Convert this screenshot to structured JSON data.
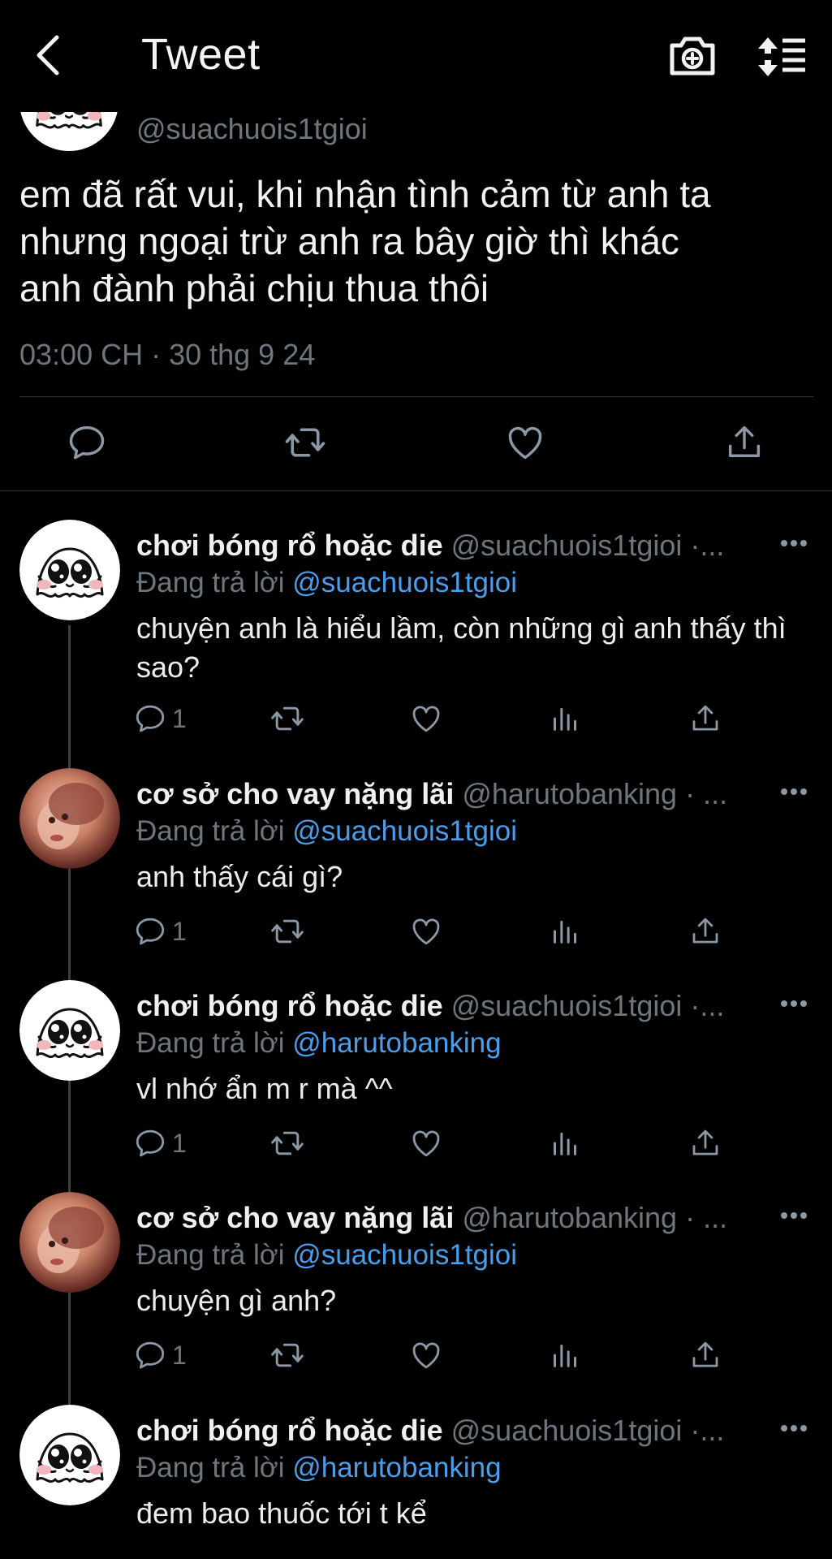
{
  "header": {
    "title": "Tweet"
  },
  "main_tweet": {
    "handle": "@suachuois1tgioi",
    "lines": [
      "em đã rất vui, khi nhận tình cảm từ anh ta",
      "nhưng ngoại trừ anh ra bây giờ thì khác",
      "anh đành phải chịu thua thôi"
    ],
    "meta": "03:00 CH · 30 thg 9 24"
  },
  "replies": [
    {
      "name": "chơi bóng rổ hoặc die",
      "handle": "@suachuois1tgioi ·...",
      "replying_label": "Đang trả lời",
      "replying_to": "@suachuois1tgioi",
      "text": "chuyện anh là hiểu lầm, còn những gì anh thấy thì sao?",
      "reply_count": "1",
      "avatar": "ghost"
    },
    {
      "name": "cơ sở cho vay nặng lãi",
      "handle": "@harutobanking · ...",
      "replying_label": "Đang trả lời",
      "replying_to": "@suachuois1tgioi",
      "text": "anh thấy cái gì?",
      "reply_count": "1",
      "avatar": "photo"
    },
    {
      "name": "chơi bóng rổ hoặc die",
      "handle": "@suachuois1tgioi ·...",
      "replying_label": "Đang trả lời",
      "replying_to": "@harutobanking",
      "text": "vl nhớ ẩn m r mà ^^",
      "reply_count": "1",
      "avatar": "ghost"
    },
    {
      "name": "cơ sở cho vay nặng lãi",
      "handle": "@harutobanking · ...",
      "replying_label": "Đang trả lời",
      "replying_to": "@suachuois1tgioi",
      "text": "chuyện gì anh?",
      "reply_count": "1",
      "avatar": "photo"
    },
    {
      "name": "chơi bóng rổ hoặc die",
      "handle": "@suachuois1tgioi ·...",
      "replying_label": "Đang trả lời",
      "replying_to": "@harutobanking",
      "text": "đem bao thuốc tới t kể",
      "reply_count": "",
      "avatar": "ghost"
    }
  ],
  "icons": {
    "back": "chevron-left-icon",
    "camera": "camera-plus-icon",
    "sort": "sort-icon",
    "reply": "comment-icon",
    "retweet": "retweet-icon",
    "like": "heart-icon",
    "views": "analytics-icon",
    "share": "share-icon",
    "more": "more-icon"
  },
  "colors": {
    "background": "#000000",
    "text": "#e7e9ea",
    "secondary": "#6e767d",
    "link": "#4c9eeb"
  }
}
